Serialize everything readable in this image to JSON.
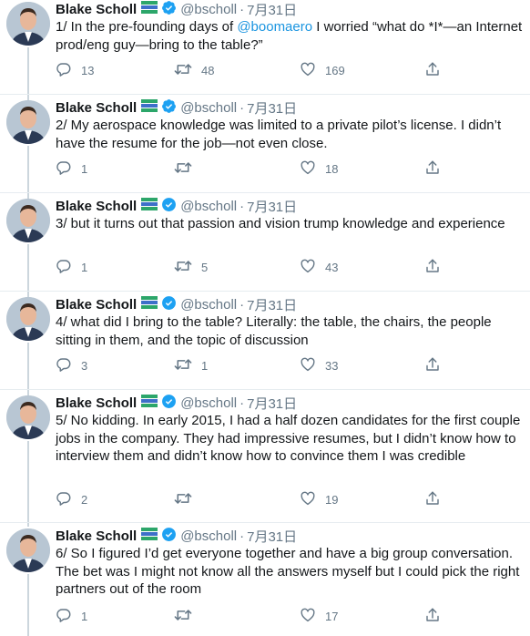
{
  "tweets": [
    {
      "name": "Blake Scholl",
      "handle": "@bscholl",
      "dot": "·",
      "date": "7月31日",
      "text_before": "1/ In the pre-founding days of ",
      "mention": "@boomaero",
      "text_after": " I worried “what do *I*—an Internet prod/eng guy—bring to the table?”",
      "replies": "13",
      "retweets": "48",
      "likes": "169"
    },
    {
      "name": "Blake Scholl",
      "handle": "@bscholl",
      "dot": "·",
      "date": "7月31日",
      "text": "2/ My aerospace knowledge was limited to a private pilot’s license. I didn’t have the resume for the job—not even close.",
      "replies": "1",
      "retweets": "",
      "likes": "18"
    },
    {
      "name": "Blake Scholl",
      "handle": "@bscholl",
      "dot": "·",
      "date": "7月31日",
      "text": "3/ but it turns out that passion and vision trump knowledge and experience",
      "replies": "1",
      "retweets": "5",
      "likes": "43"
    },
    {
      "name": "Blake Scholl",
      "handle": "@bscholl",
      "dot": "·",
      "date": "7月31日",
      "text": "4/ what did I bring to the table? Literally: the table, the chairs, the people sitting in them, and the topic of discussion",
      "replies": "3",
      "retweets": "1",
      "likes": "33"
    },
    {
      "name": "Blake Scholl",
      "handle": "@bscholl",
      "dot": "·",
      "date": "7月31日",
      "text": "5/ No kidding. In early 2015, I had a half dozen candidates for the first couple jobs in the company. They had impressive resumes, but I didn’t know how to interview them and didn’t know how to convince them I was credible",
      "replies": "2",
      "retweets": "",
      "likes": "19"
    },
    {
      "name": "Blake Scholl",
      "handle": "@bscholl",
      "dot": "·",
      "date": "7月31日",
      "text": "6/ So I figured I’d get everyone together and have a big group conversation. The bet was I might not know all the answers myself but I could pick the right partners out of the room",
      "replies": "1",
      "retweets": "",
      "likes": "17"
    }
  ],
  "colors": {
    "text": "#14171a",
    "muted": "#657786",
    "link": "#1b95e0",
    "verified": "#1da1f2",
    "thread_line": "#ccd6dd"
  },
  "icons": {
    "reply": "reply-icon",
    "retweet": "retweet-icon",
    "like": "heart-icon",
    "share": "share-icon",
    "verified": "verified-badge-icon",
    "flag": "flag-icon"
  }
}
